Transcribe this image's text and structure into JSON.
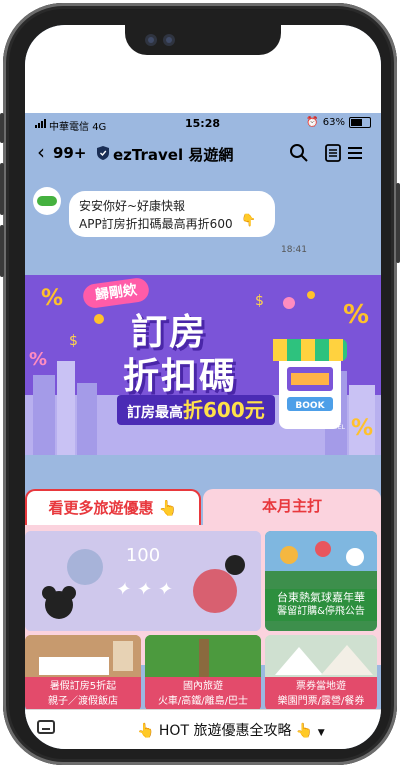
{
  "status": {
    "carrier": "中華電信",
    "network": "4G",
    "time": "15:28",
    "battery": "63%"
  },
  "header": {
    "unread_count": "99+",
    "title": "ezTravel 易遊網"
  },
  "message": {
    "line1": "安安你好~好康快報",
    "line2": "APP訂房折扣碼最高再折600",
    "time": "18:41"
  },
  "banner": {
    "tag": "歸剛欸",
    "title_line1": "訂房",
    "title_line2": "折扣碼",
    "subtitle_prefix": "訂房最高",
    "subtitle_highlight": "折600元",
    "shop_sign": "BOOK",
    "hotel_label": "HOTEL"
  },
  "tabs": [
    {
      "label": "看更多旅遊優惠"
    },
    {
      "label": "本月主打"
    }
  ],
  "tiles": {
    "featured_text": "100",
    "balloon_title": "台東熱氣球嘉年華",
    "balloon_sub": "馨留訂購&停飛公告",
    "hotel_title": "暑假訂房5折起",
    "hotel_sub": "親子／渡假飯店",
    "domestic_title": "國內旅遊",
    "domestic_sub": "火車/高鐵/離島/巴士",
    "tickets_title": "票券當地遊",
    "tickets_sub": "樂園門票/露營/餐券"
  },
  "menu": {
    "label": "HOT 旅遊優惠全攻略"
  }
}
